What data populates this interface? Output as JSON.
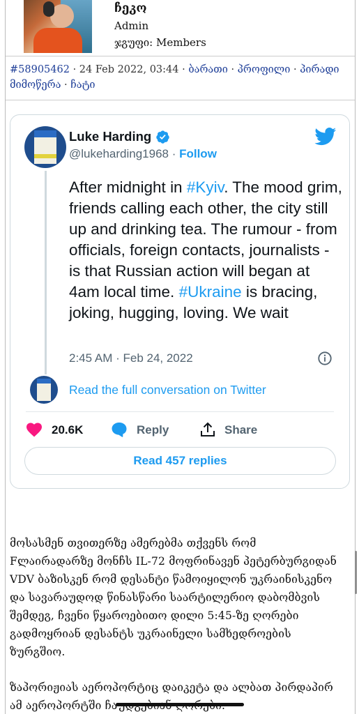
{
  "post": {
    "author": "ჩეკო",
    "role": "Admin",
    "group_label": "ჯგუფი: Members"
  },
  "meta": {
    "post_id": "#58905462",
    "datetime": "24 Feb 2022, 03:44",
    "link_rate": "ბარათი",
    "link_profile": "პროფილი",
    "link_pm": "პირადი მიმოწერა",
    "link_chat": "ჩატი",
    "dot": "·"
  },
  "tweet": {
    "name": "Luke Harding",
    "handle": "@lukeharding1968",
    "dot": " · ",
    "follow": "Follow",
    "text_1": "After midnight in ",
    "tag_1": "#Kyiv",
    "text_2": ". The mood grim, friends calling each other, the city still up and drinking tea. The rumour - from officials, foreign contacts, journalists - is that Russian action will began at 4am local time. ",
    "tag_2": "#Ukraine",
    "text_3": " is bracing, joking, hugging, loving. We wait",
    "time": "2:45 AM · Feb 24, 2022",
    "read_full": "Read the full conversation on Twitter",
    "likes": "20.6K",
    "reply": "Reply",
    "share": "Share",
    "read_replies": "Read 457 replies",
    "colors": {
      "accent": "#1d9bf0",
      "like": "#f91880",
      "muted": "#536471"
    }
  },
  "body": {
    "paragraph_1": "მოსასმენ თვითერზე ამერებმა თქვენს რომ Fლაირადარზე მონჩს IL-72 მოფრინავენ პეტერბურგიდან VDV ბაზისკენ რომ დესანტი წამოიყილონ უკრაინისკენო და სავარაუდოდ წინასწარი საარტილერიო დაბომბვის შემდეგ, ჩვენი წყაროებითო დილი 5:45-ზე ღორები გადმოყრიან დესანტს უკრაინელი სამხედროების ზურგშიო.",
    "paragraph_2": "ზაპორიჟიას აეროპორტიც დაიკეტა და ალბათ პირდაპირ ამ აეროპორტში ჩაუდგებიან ღორები."
  }
}
